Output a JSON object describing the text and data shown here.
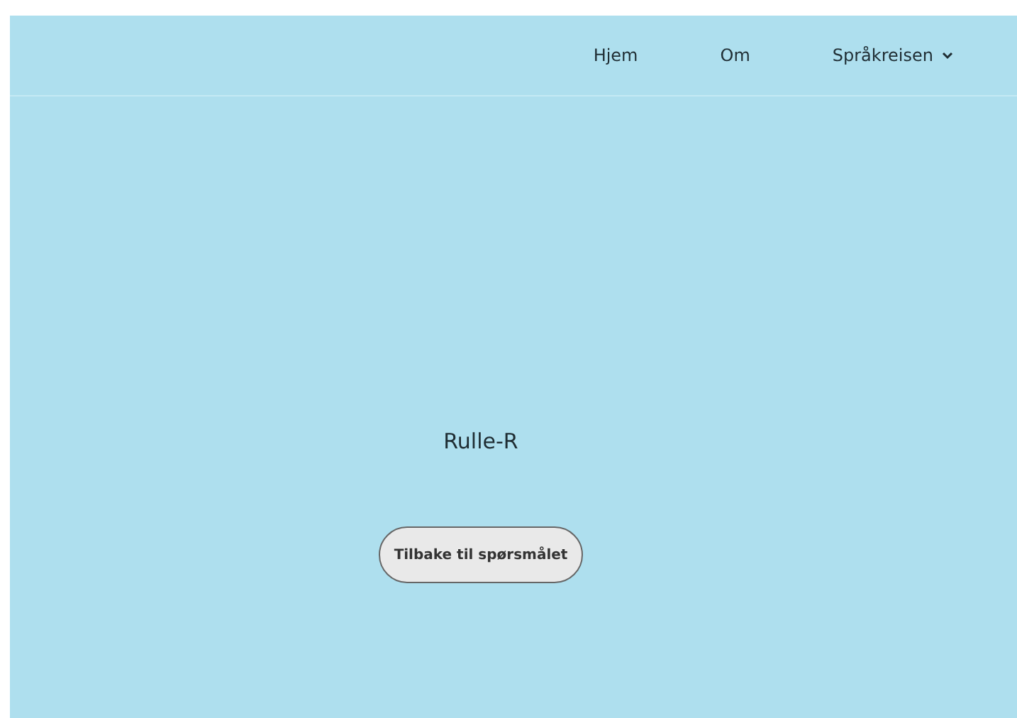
{
  "nav": {
    "items": [
      {
        "label": "Hjem",
        "kind": "link"
      },
      {
        "label": "Om",
        "kind": "link"
      },
      {
        "label": "Språkreisen",
        "kind": "dropdown"
      }
    ]
  },
  "main": {
    "heading": "Rulle-R",
    "button": "Tilbake til spørsmålet"
  }
}
